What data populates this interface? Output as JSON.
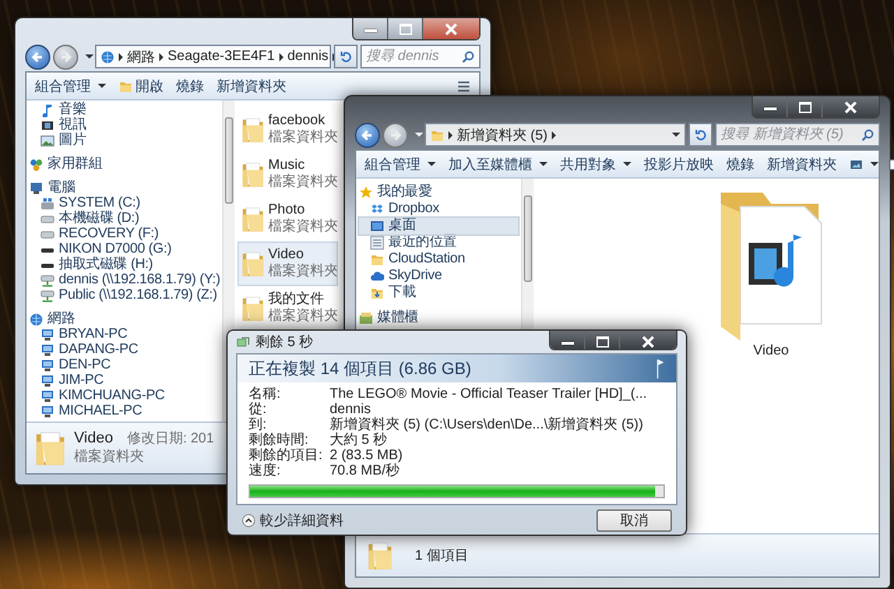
{
  "explorer_back": {
    "address": [
      "網路",
      "Seagate-3EE4F1",
      "dennis"
    ],
    "search": {
      "placeholder": "搜尋 dennis"
    },
    "toolbar": [
      {
        "label": "組合管理",
        "kind": "menu"
      },
      {
        "label": "開啟",
        "kind": "open"
      },
      {
        "label": "燒錄",
        "kind": "plain"
      },
      {
        "label": "新增資料夾",
        "kind": "plain"
      }
    ],
    "nav": [
      {
        "children": [
          {
            "label": "音樂",
            "kind": "music"
          },
          {
            "label": "視訊",
            "kind": "video"
          },
          {
            "label": "圖片",
            "kind": "pictures"
          }
        ]
      },
      {
        "label": "家用群組",
        "kind": "homegroup"
      },
      {
        "label": "電腦",
        "kind": "computer",
        "children": [
          {
            "label": "SYSTEM (C:)",
            "kind": "system-drive"
          },
          {
            "label": "本機磁碟 (D:)",
            "kind": "drive"
          },
          {
            "label": "RECOVERY (F:)",
            "kind": "drive"
          },
          {
            "label": "NIKON D7000 (G:)",
            "kind": "removable"
          },
          {
            "label": "抽取式磁碟 (H:)",
            "kind": "removable"
          },
          {
            "label": "dennis (\\\\192.168.1.79) (Y:)",
            "kind": "network-drive"
          },
          {
            "label": "Public (\\\\192.168.1.79) (Z:)",
            "kind": "network-drive"
          }
        ]
      },
      {
        "label": "網路",
        "kind": "network",
        "children": [
          {
            "label": "BRYAN-PC",
            "kind": "pc"
          },
          {
            "label": "DAPANG-PC",
            "kind": "pc"
          },
          {
            "label": "DEN-PC",
            "kind": "pc"
          },
          {
            "label": "JIM-PC",
            "kind": "pc"
          },
          {
            "label": "KIMCHUANG-PC",
            "kind": "pc"
          },
          {
            "label": "MICHAEL-PC",
            "kind": "pc"
          }
        ]
      }
    ],
    "files": [
      {
        "name": "facebook",
        "type": "檔案資料夾",
        "selected": false
      },
      {
        "name": "Music",
        "type": "檔案資料夾",
        "selected": false
      },
      {
        "name": "Photo",
        "type": "檔案資料夾",
        "selected": false
      },
      {
        "name": "Video",
        "type": "檔案資料夾",
        "selected": true
      },
      {
        "name": "我的文件",
        "type": "檔案資料夾",
        "selected": false
      }
    ],
    "details": {
      "name": "Video",
      "type": "檔案資料夾",
      "modified": "修改日期: 201"
    }
  },
  "explorer_front": {
    "address": [
      "新增資料夾 (5)"
    ],
    "search": {
      "placeholder": "搜尋 新增資料夾 (5)"
    },
    "toolbar": [
      {
        "label": "組合管理",
        "kind": "menu"
      },
      {
        "label": "加入至媒體櫃",
        "kind": "menu"
      },
      {
        "label": "共用對象",
        "kind": "menu"
      },
      {
        "label": "投影片放映",
        "kind": "plain"
      },
      {
        "label": "燒錄",
        "kind": "plain"
      },
      {
        "label": "新增資料夾",
        "kind": "plain"
      }
    ],
    "nav": [
      {
        "label": "我的最愛",
        "kind": "star",
        "children": [
          {
            "label": "Dropbox",
            "kind": "dropbox",
            "selected": false
          },
          {
            "label": "桌面",
            "kind": "desktop",
            "selected": true
          },
          {
            "label": "最近的位置",
            "kind": "recent",
            "selected": false
          },
          {
            "label": "CloudStation",
            "kind": "folder",
            "selected": false
          },
          {
            "label": "SkyDrive",
            "kind": "cloud",
            "selected": false
          },
          {
            "label": "下載",
            "kind": "downloads",
            "selected": false
          }
        ]
      },
      {
        "label": "媒體櫃",
        "kind": "library"
      }
    ],
    "items": [
      {
        "name": "Video"
      }
    ],
    "status": "1 個項目"
  },
  "copy_dialog": {
    "title": "剩餘 5 秒",
    "heading": "正在複製 14 個項目 (6.86 GB)",
    "rows": [
      {
        "label": "名稱:",
        "value": "The LEGO® Movie - Official Teaser Trailer [HD]_(..."
      },
      {
        "label": "從:",
        "value": "dennis"
      },
      {
        "label": "到:",
        "value": "新增資料夾 (5) (C:\\Users\\den\\De...\\新增資料夾 (5))"
      },
      {
        "label": "剩餘時間:",
        "value": "大約 5 秒"
      },
      {
        "label": "剩餘的項目:",
        "value": "2 (83.5 MB)"
      },
      {
        "label": "速度:",
        "value": "70.8 MB/秒"
      }
    ],
    "progress": {
      "level": 0.98
    },
    "more_button": "較少詳細資料",
    "cancel_button": "取消"
  }
}
